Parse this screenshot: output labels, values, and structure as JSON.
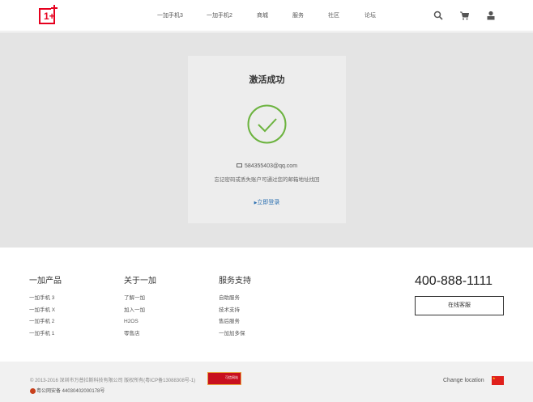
{
  "header": {
    "logo": "1+",
    "nav": [
      "一加手机3",
      "一加手机2",
      "商城",
      "服务",
      "社区",
      "论坛"
    ],
    "icons": [
      "search-icon",
      "cart-icon",
      "user-icon"
    ]
  },
  "card": {
    "title": "激活成功",
    "email": "584355403@qq.com",
    "hint": "忘记密码或丢失账户可通过您的邮箱地址找回",
    "login": "立即登录",
    "accent": "#6cb33f"
  },
  "footer": {
    "columns": [
      {
        "title": "一加产品",
        "items": [
          "一加手机 3",
          "一加手机 X",
          "一加手机 2",
          "一加手机 1"
        ]
      },
      {
        "title": "关于一加",
        "items": [
          "了解一加",
          "加入一加",
          "H2OS",
          "零售店"
        ]
      },
      {
        "title": "服务支持",
        "items": [
          "自助服务",
          "技术支持",
          "售后服务",
          "一加加多保"
        ]
      }
    ],
    "phone": "400-888-1111",
    "service_button": "在线客服",
    "copyright": "© 2013-2016 深圳市万普拉斯科技有限公司 版权所有(粤ICP备13088308号-1)",
    "police": "粤公网安备 44030402000178号",
    "badge": "可信网站",
    "change_location": "Change location"
  }
}
